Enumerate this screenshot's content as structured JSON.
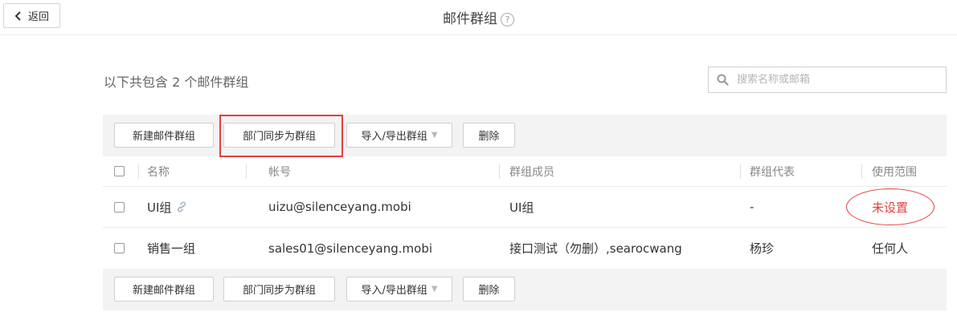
{
  "header": {
    "back_label": "返回",
    "title": "邮件群组",
    "help_glyph": "?"
  },
  "summary": "以下共包含 2 个邮件群组",
  "search": {
    "placeholder": "搜索名称或邮箱",
    "value": ""
  },
  "toolbar": {
    "new_group": "新建邮件群组",
    "sync_dept": "部门同步为群组",
    "import_export": "导入/导出群组",
    "delete": "删除"
  },
  "table": {
    "headers": {
      "name": "名称",
      "account": "帐号",
      "members": "群组成员",
      "representative": "群组代表",
      "scope": "使用范围"
    },
    "rows": [
      {
        "name": "UI组",
        "account": "uizu@silenceyang.mobi",
        "members": "UI组",
        "representative": "-",
        "scope": "未设置"
      },
      {
        "name": "销售一组",
        "account": "sales01@silenceyang.mobi",
        "members": "接口测试（勿删）,searocwang",
        "representative": "杨珍",
        "scope": "任何人"
      }
    ]
  },
  "colors": {
    "accent_red": "#e3403b",
    "toolbar_bg": "#f3f3f4"
  },
  "icons": [
    "chevron-left-icon",
    "help-icon",
    "search-icon",
    "link-icon",
    "caret-down-icon"
  ]
}
